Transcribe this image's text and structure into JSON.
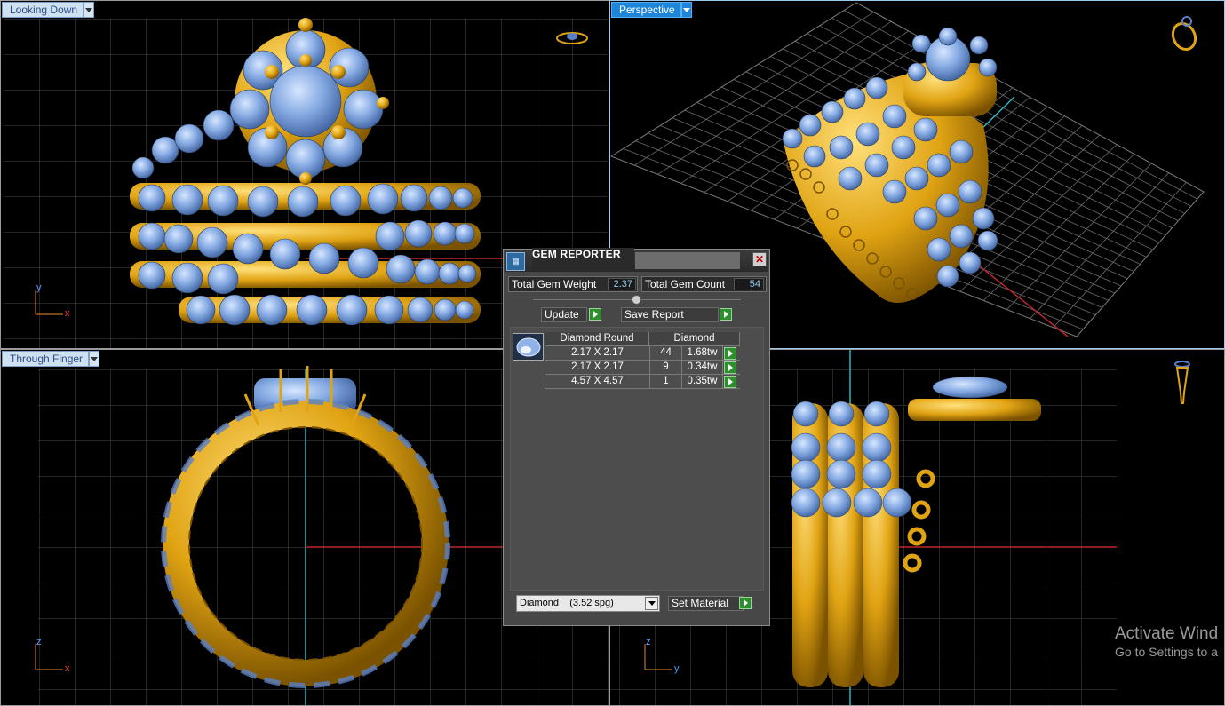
{
  "viewports": {
    "top_left": {
      "label": "Looking Down",
      "axis_v": "y",
      "axis_h": "x"
    },
    "top_right": {
      "label": "Perspective"
    },
    "bottom_left": {
      "label": "Through Finger",
      "axis_v": "z",
      "axis_h": "x"
    },
    "bottom_right": {
      "label": "",
      "axis_v": "z",
      "axis_h": "y"
    }
  },
  "gem_reporter": {
    "title": "GEM REPORTER",
    "close_glyph": "✕",
    "total_gem_weight_label": "Total Gem Weight",
    "total_gem_weight": "2.37",
    "total_gem_count_label": "Total Gem Count",
    "total_gem_count": "54",
    "update_label": "Update",
    "save_report_label": "Save Report",
    "table": {
      "header_shape": "Diamond Round",
      "header_material": "Diamond",
      "rows": [
        {
          "size": "2.17 X 2.17",
          "count": "44",
          "weight": "1.68tw"
        },
        {
          "size": "2.17 X 2.17",
          "count": "9",
          "weight": "0.34tw"
        },
        {
          "size": "4.57 X 4.57",
          "count": "1",
          "weight": "0.35tw"
        }
      ]
    },
    "material_select": "Diamond    (3.52 spg)",
    "set_material_label": "Set Material"
  },
  "watermark": {
    "line1": "Activate Wind",
    "line2": "Go to Settings to a"
  },
  "colors": {
    "gold": "#e0a313",
    "gem": "#7fa6e0",
    "grid": "#555555",
    "accent_select": "#1e86d8"
  }
}
